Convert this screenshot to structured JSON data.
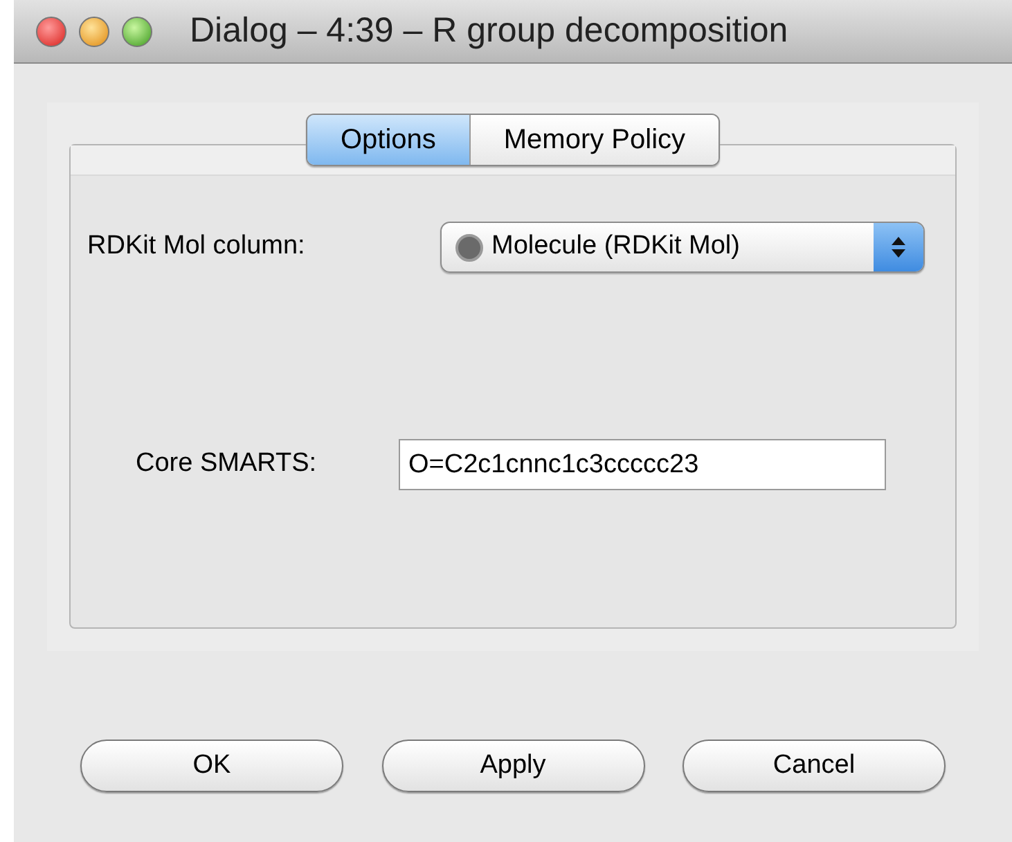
{
  "window": {
    "title": "Dialog – 4:39 – R group decomposition"
  },
  "tabs": [
    {
      "label": "Options",
      "selected": true
    },
    {
      "label": "Memory Policy",
      "selected": false
    }
  ],
  "mol_column": {
    "label": "RDKit Mol column:",
    "value": "Molecule (RDKit Mol)"
  },
  "core_smarts": {
    "label": "Core SMARTS:",
    "value": "O=C2c1cnnc1c3ccccc23"
  },
  "buttons": [
    "OK",
    "Apply",
    "Cancel"
  ]
}
